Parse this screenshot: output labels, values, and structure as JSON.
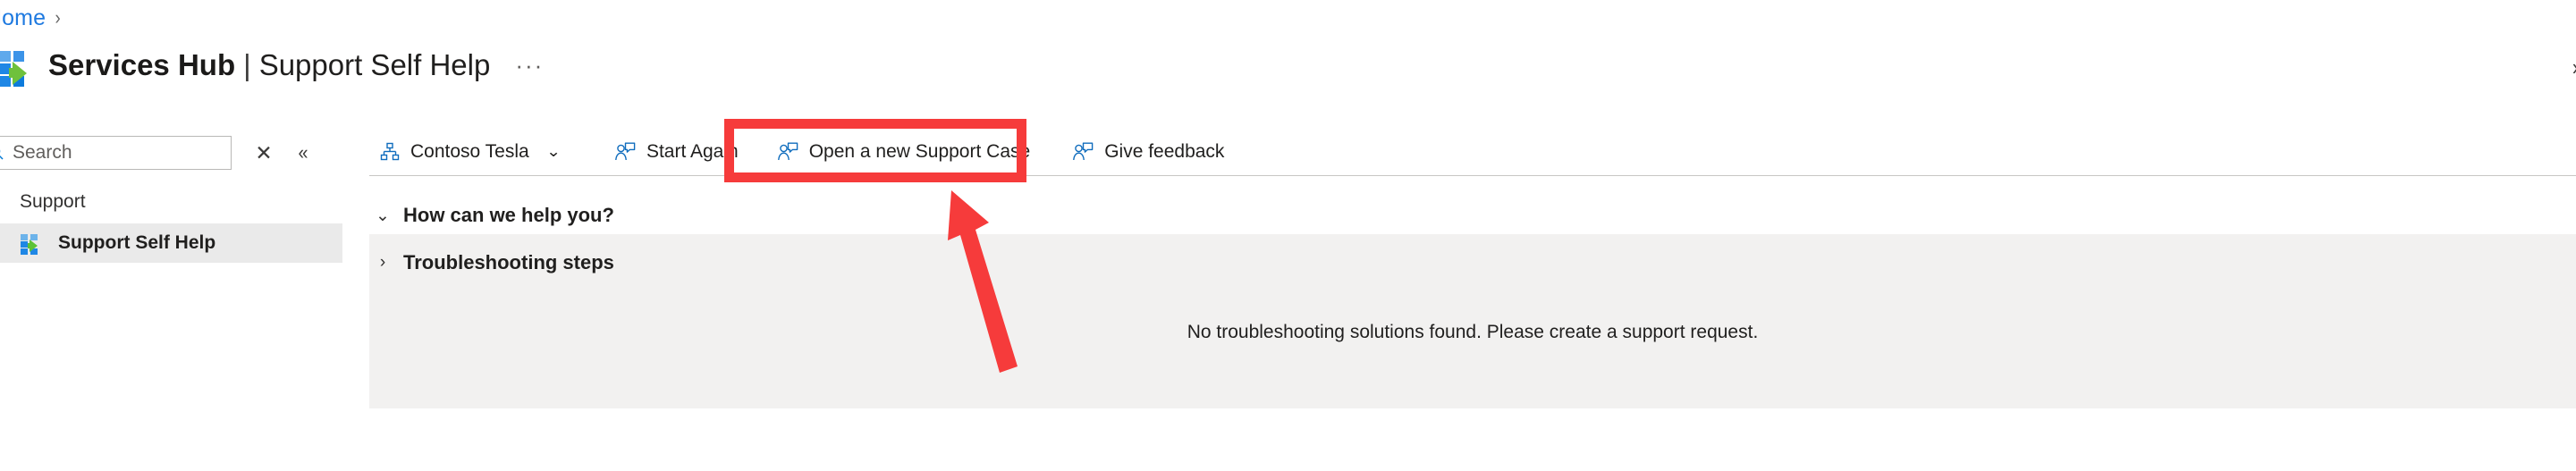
{
  "breadcrumb": {
    "items": [
      {
        "label": "Home",
        "separator": "›"
      }
    ]
  },
  "header": {
    "logo_icon": "services-hub-logo-icon",
    "title": "Services Hub",
    "separator": "|",
    "subtitle": "Support Self Help",
    "overflow_label": "···",
    "right_expand_icon": "chevron-right-icon",
    "right_expand_glyph": "›"
  },
  "sidebar": {
    "search": {
      "icon": "search-icon",
      "placeholder": "Search",
      "value": "",
      "clear_glyph": "✕",
      "collapse_glyph": "«"
    },
    "group": {
      "label": "Support",
      "caret_glyph": "⌄",
      "expanded": true
    },
    "items": [
      {
        "label": "Support Self Help",
        "icon": "services-hub-logo-icon",
        "selected": true
      }
    ],
    "selected_background": "#eaeaea"
  },
  "commandbar": {
    "items": [
      {
        "label": "Contoso Tesla",
        "icon": "org-hierarchy-icon",
        "has_caret": true,
        "caret_glyph": "⌄",
        "highlighted": false
      },
      {
        "label": "Start Again",
        "icon": "support-case-icon",
        "has_caret": false,
        "highlighted": false
      },
      {
        "label": "Open a new Support Case",
        "icon": "support-case-icon",
        "has_caret": false,
        "highlighted": true
      },
      {
        "label": "Give feedback",
        "icon": "support-case-icon",
        "has_caret": false,
        "highlighted": false
      }
    ]
  },
  "main": {
    "sections": [
      {
        "title": "How can we help you?",
        "expanded": true,
        "caret_glyph": "⌄"
      },
      {
        "title": "Troubleshooting steps",
        "expanded": false,
        "caret_glyph": "›"
      }
    ],
    "empty_message": "No troubleshooting solutions found. Please create a support request.",
    "panel_background": "#f2f1f0"
  },
  "annotations": {
    "highlight_color": "#f63b3b",
    "highlight_target": "Open a new Support Case",
    "arrow_points_to": "Open a new Support Case"
  },
  "colors": {
    "link": "#1f7ae0",
    "accent_blue": "#0078d4",
    "logo_green": "#6fc13c",
    "text_primary": "#201f1e",
    "text_secondary": "#605e5c",
    "annotation_red": "#f63b3b"
  }
}
